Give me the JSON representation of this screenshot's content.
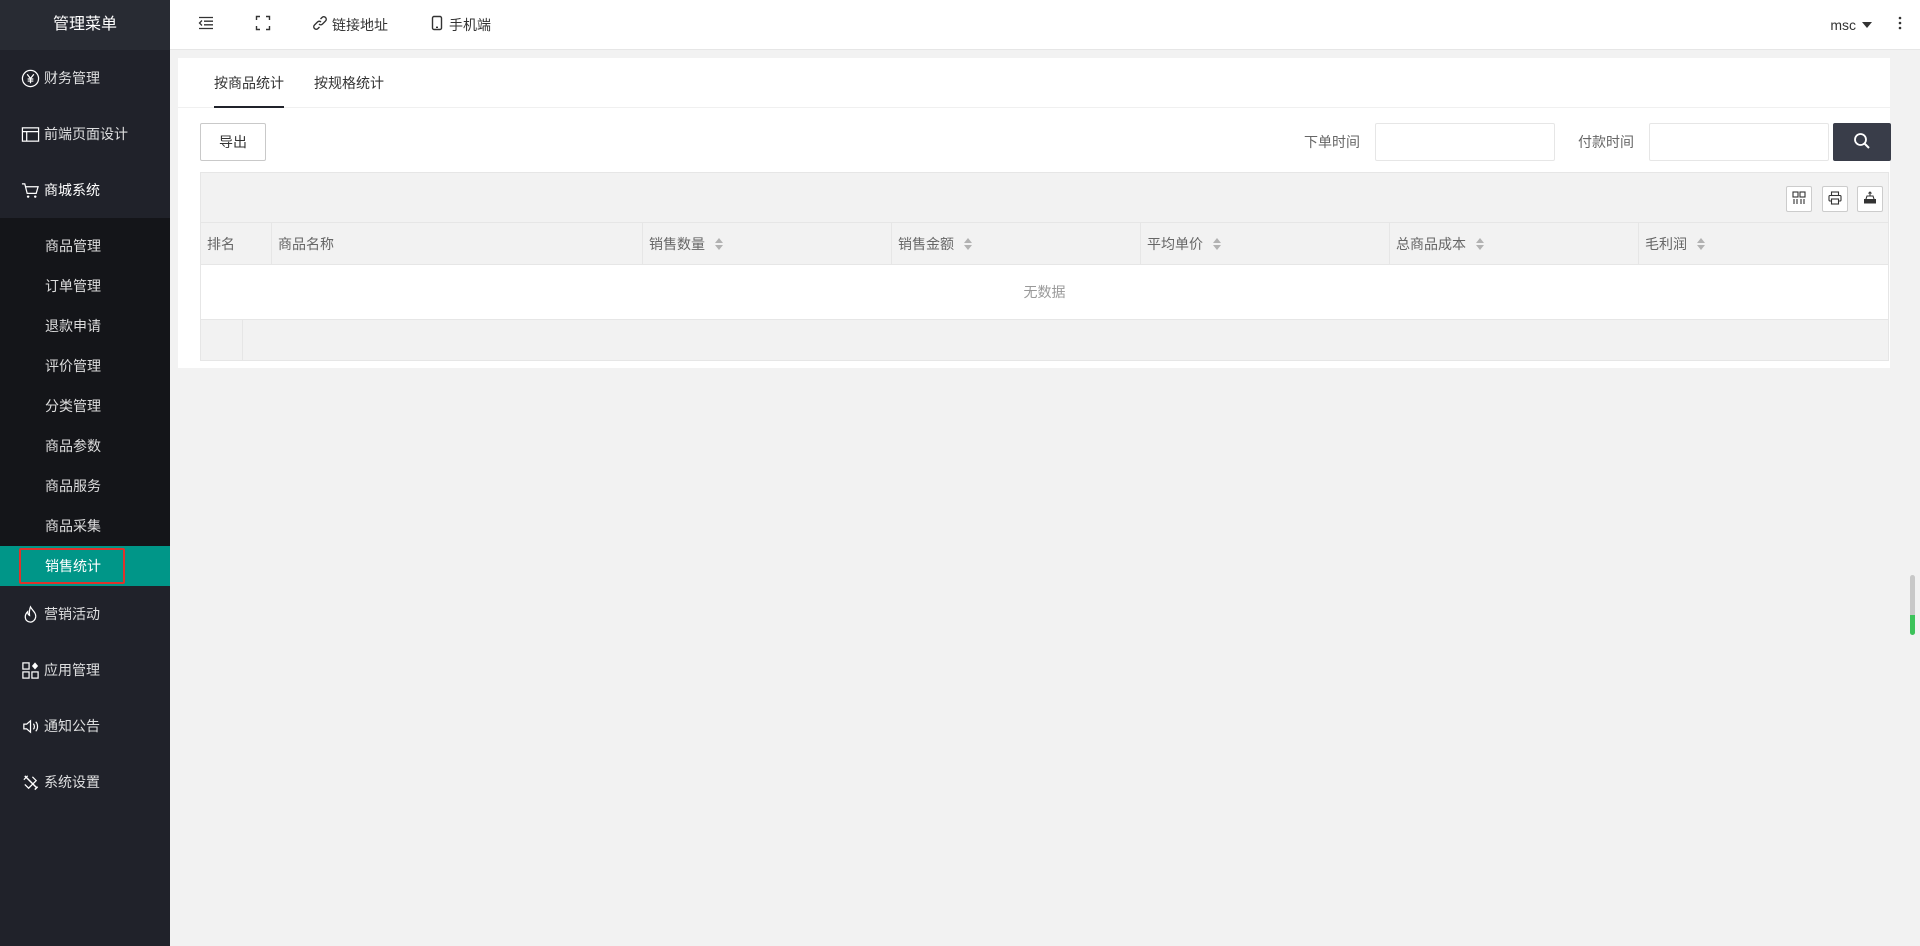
{
  "sidebar": {
    "title": "管理菜单",
    "items": [
      {
        "label": "财务管理",
        "icon": "yen-circle-icon"
      },
      {
        "label": "前端页面设计",
        "icon": "layout-icon"
      },
      {
        "label": "商城系统",
        "icon": "cart-icon"
      }
    ],
    "sub_items": [
      {
        "label": "商品管理"
      },
      {
        "label": "订单管理"
      },
      {
        "label": "退款申请"
      },
      {
        "label": "评价管理"
      },
      {
        "label": "分类管理"
      },
      {
        "label": "商品参数"
      },
      {
        "label": "商品服务"
      },
      {
        "label": "商品采集"
      },
      {
        "label": "销售统计"
      }
    ],
    "bottom_items": [
      {
        "label": "营销活动",
        "icon": "fire-icon"
      },
      {
        "label": "应用管理",
        "icon": "apps-icon"
      },
      {
        "label": "通知公告",
        "icon": "speaker-icon"
      },
      {
        "label": "系统设置",
        "icon": "tools-icon"
      }
    ],
    "active_color": "#009688"
  },
  "header": {
    "link_label": "链接地址",
    "mobile_label": "手机端",
    "user": "msc"
  },
  "tabs": [
    {
      "label": "按商品统计"
    },
    {
      "label": "按规格统计"
    }
  ],
  "toolbar": {
    "export_label": "导出",
    "order_time_label": "下单时间",
    "pay_time_label": "付款时间"
  },
  "table": {
    "columns": [
      "排名",
      "商品名称",
      "销售数量",
      "销售金额",
      "平均单价",
      "总商品成本",
      "毛利润"
    ],
    "empty_text": "无数据"
  }
}
